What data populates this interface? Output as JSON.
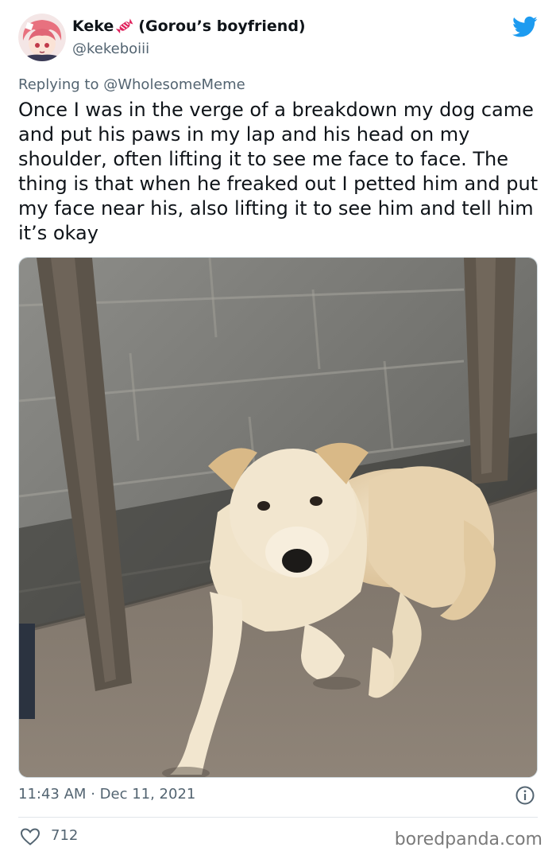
{
  "author": {
    "display_name": "Keke",
    "name_suffix": "(Gorou’s boyfriend)",
    "handle": "@kekeboiii",
    "avatar": "anime-avatar",
    "name_emoji": "candy-icon"
  },
  "reply": {
    "prefix": "Replying to",
    "target": "@WholesomeMeme"
  },
  "tweet": {
    "text": "Once I was in the verge of a breakdown my dog came and put his paws in my lap and his head on my shoulder, often lifting it to see me face to face. The thing is that when he freaked out I petted him and put my face near his, also lifting it to see him and tell him it’s okay",
    "photo": "dog-photo"
  },
  "meta": {
    "time": "11:43 AM",
    "separator": "·",
    "date": "Dec 11, 2021"
  },
  "engagement": {
    "likes": "712"
  },
  "watermark": "boredpanda.com",
  "colors": {
    "twitter_blue": "#1d9bf0",
    "secondary_text": "#536471",
    "primary_text": "#0f1419"
  }
}
